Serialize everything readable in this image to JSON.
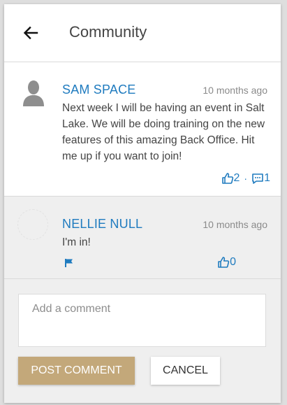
{
  "header": {
    "title": "Community",
    "back_icon": "arrow-left-icon"
  },
  "posts": [
    {
      "author": "SAM SPACE",
      "time": "10 months ago",
      "text": "Next week I will be having an event in Salt Lake. We will be doing training on the new features of this amazing Back Office. Hit me up if you want to join!",
      "likes": "2",
      "separator": "·",
      "comments": "1",
      "avatar_icon": "person-silhouette-icon"
    },
    {
      "author": "NELLIE NULL",
      "time": "10 months ago",
      "text": "I'm in!",
      "likes": "0",
      "flag_icon": "flag-icon"
    }
  ],
  "comment_form": {
    "placeholder": "Add a comment",
    "post_label": "POST COMMENT",
    "cancel_label": "CANCEL"
  },
  "colors": {
    "accent": "#1f7bbf",
    "post_button": "#c3a87a"
  }
}
